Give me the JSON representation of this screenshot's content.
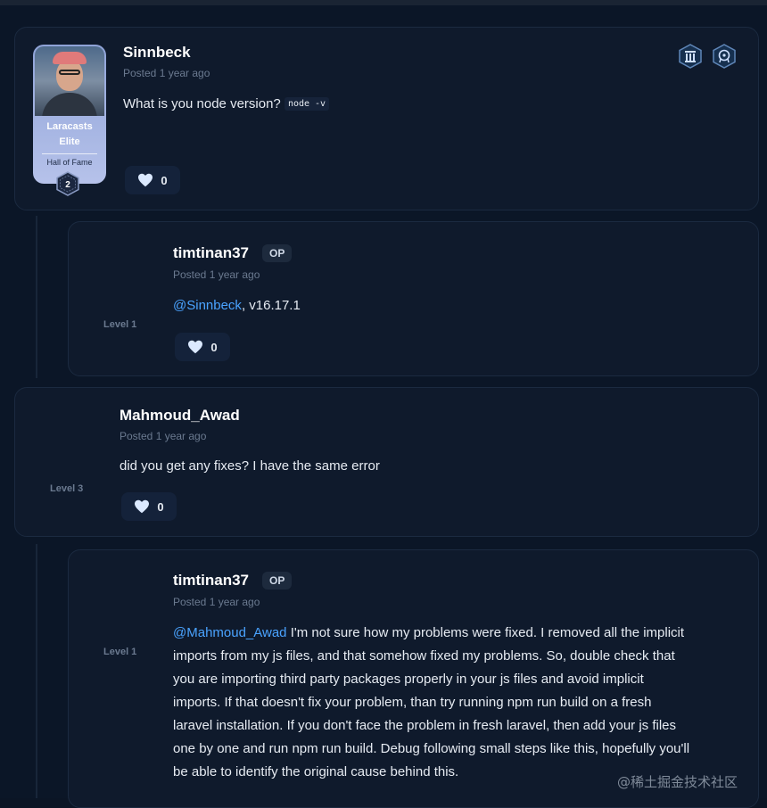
{
  "posts": [
    {
      "username": "Sinnbeck",
      "posted": "Posted 1 year ago",
      "body_text": "What is you node version?",
      "code": "node -v",
      "likes": "0",
      "elite": {
        "line1": "Laracasts",
        "line2": "Elite",
        "hall_of_fame": "Hall of Fame",
        "level": "2"
      },
      "badges": [
        "pillar-badge-icon",
        "brain-badge-icon"
      ]
    },
    {
      "username": "timtinan37",
      "op_label": "OP",
      "posted": "Posted 1 year ago",
      "mention": "@Sinnbeck",
      "body_text": ", v16.17.1",
      "likes": "0",
      "level": "Level 1"
    },
    {
      "username": "Mahmoud_Awad",
      "posted": "Posted 1 year ago",
      "body_text": "did you get any fixes? I have the same error",
      "likes": "0",
      "level": "Level 3"
    },
    {
      "username": "timtinan37",
      "op_label": "OP",
      "posted": "Posted 1 year ago",
      "mention": "@Mahmoud_Awad",
      "lines": [
        " I'm not sure how my problems were fixed. I removed all the implicit",
        "imports from my js files, and that somehow fixed my problems. So, double check that",
        "you are importing third party packages properly in your js files and avoid implicit",
        "imports. If that doesn't fix your problem, than try running npm run build on a fresh",
        "laravel installation. If you don't face the problem in fresh laravel, then add your js files",
        "one by one and run npm run build. Debug following small steps like this, hopefully you'll",
        "be able to identify the original cause behind this."
      ],
      "level": "Level 1"
    }
  ],
  "watermark": "@稀土掘金技术社区",
  "colors": {
    "background": "#0b1627",
    "card": "#0f1a2c",
    "mention": "#4aa3ff",
    "muted": "#6b7a90"
  }
}
